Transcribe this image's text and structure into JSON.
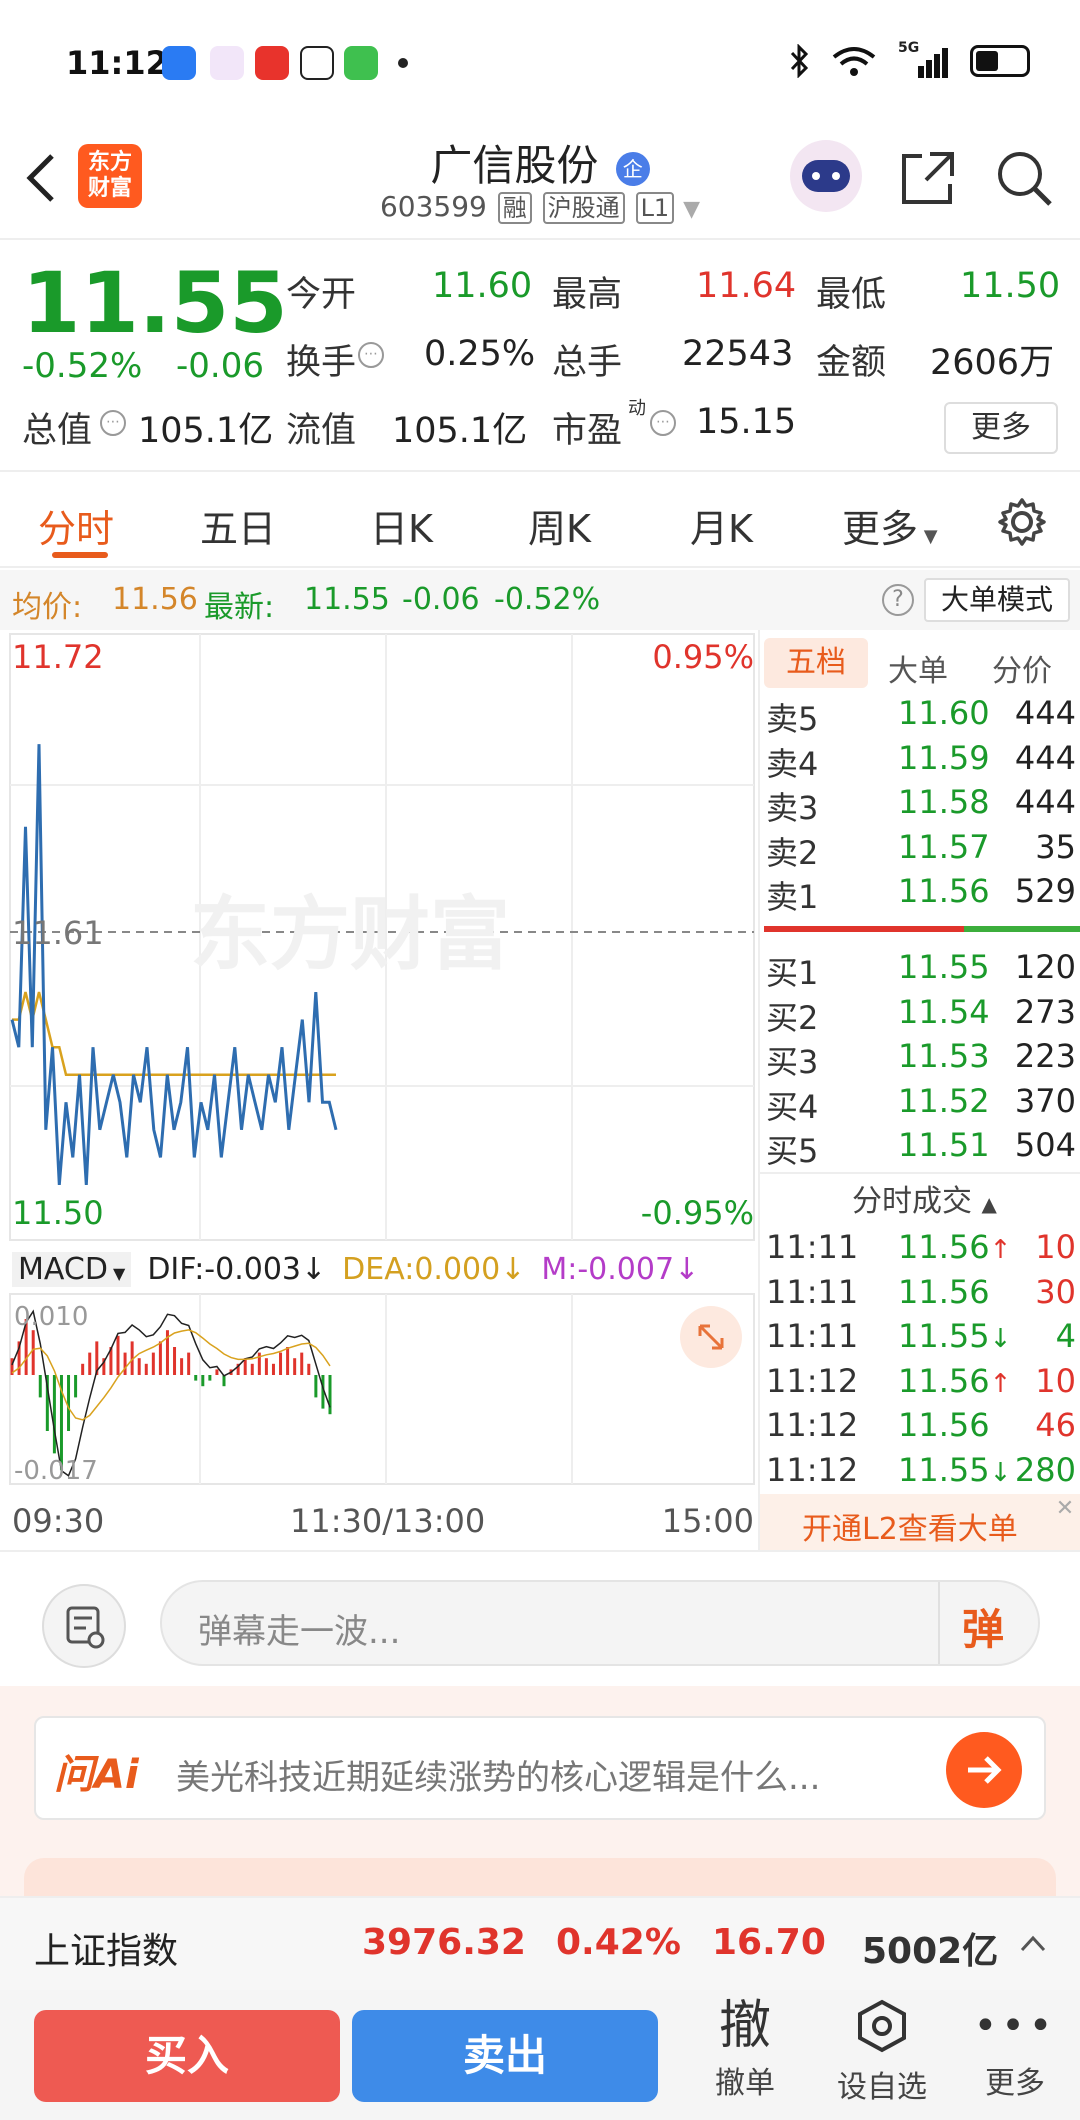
{
  "status_bar": {
    "time": "11:12",
    "network": "5G"
  },
  "header": {
    "title": "广信股份",
    "title_badge": "企",
    "app_logo_line1": "东方",
    "app_logo_line2": "财富",
    "code": "603599",
    "tags": [
      "融",
      "沪股通",
      "L1"
    ]
  },
  "quote": {
    "price": "11.55",
    "pct_change": "-0.52%",
    "abs_change": "-0.06",
    "fields": [
      {
        "label": "今开",
        "value": "11.60",
        "color": "green"
      },
      {
        "label": "最高",
        "value": "11.64",
        "color": "red"
      },
      {
        "label": "最低",
        "value": "11.50",
        "color": "green"
      },
      {
        "label": "换手",
        "value": "0.25%",
        "color": "black"
      },
      {
        "label": "总手",
        "value": "22543",
        "color": "black"
      },
      {
        "label": "金额",
        "value": "2606万",
        "color": "black"
      },
      {
        "label": "总值",
        "value": "105.1亿",
        "color": "black"
      },
      {
        "label": "流值",
        "value": "105.1亿",
        "color": "black"
      },
      {
        "label": "市盈",
        "value": "15.15",
        "color": "black"
      }
    ],
    "pe_superscript": "动",
    "more_label": "更多"
  },
  "tabs": [
    "分时",
    "五日",
    "日K",
    "周K",
    "月K",
    "更多"
  ],
  "info_line": {
    "avg_label": "均价:",
    "avg_value": "11.56",
    "latest_label": "最新:",
    "latest_value": "11.55",
    "latest_change": "-0.06",
    "latest_pct": "-0.52%",
    "big_order_mode": "大单模式"
  },
  "chart": {
    "y_top": "11.72",
    "y_mid": "11.61",
    "y_bottom": "11.50",
    "pct_top": "0.95%",
    "pct_bottom": "-0.95%",
    "watermark": "东方财富",
    "macd_label": "MACD",
    "dif": "DIF:-0.003",
    "dea": "DEA:0.000",
    "m": "M:-0.007",
    "macd_top": "0.010",
    "macd_bottom": "-0.017",
    "x_start": "09:30",
    "x_mid": "11:30/13:00",
    "x_end": "15:00"
  },
  "chart_data": {
    "type": "line",
    "series": [],
    "price_line": [
      11.58,
      11.57,
      11.65,
      11.57,
      11.68,
      11.54,
      11.57,
      11.52,
      11.55,
      11.53,
      11.56,
      11.52,
      11.57,
      11.54,
      11.55,
      11.56,
      11.55,
      11.53,
      11.56,
      11.55,
      11.57,
      11.54,
      11.53,
      11.56,
      11.54,
      11.55,
      11.57,
      11.53,
      11.55,
      11.54,
      11.56,
      11.53,
      11.55,
      11.57,
      11.54,
      11.56,
      11.55,
      11.54,
      11.56,
      11.55,
      11.57,
      11.54,
      11.56,
      11.58,
      11.55,
      11.59,
      11.55,
      11.55,
      11.54
    ],
    "avg_line": [
      11.58,
      11.58,
      11.59,
      11.58,
      11.59,
      11.58,
      11.57,
      11.57,
      11.56,
      11.56,
      11.56,
      11.56,
      11.56,
      11.56,
      11.56,
      11.56,
      11.56,
      11.56,
      11.56,
      11.56,
      11.56,
      11.56,
      11.56,
      11.56,
      11.56,
      11.56,
      11.56,
      11.56,
      11.56,
      11.56,
      11.56,
      11.56,
      11.56,
      11.56,
      11.56,
      11.56,
      11.56,
      11.56,
      11.56,
      11.56,
      11.56,
      11.56,
      11.56,
      11.56,
      11.56,
      11.56,
      11.56,
      11.56,
      11.56
    ],
    "macd_bars": [
      0.003,
      0.006,
      0.01,
      0.008,
      -0.004,
      -0.01,
      -0.014,
      -0.017,
      -0.01,
      -0.004,
      0.002,
      0.004,
      0.006,
      0.003,
      0.005,
      0.007,
      0.004,
      0.006,
      0.003,
      0.002,
      0.004,
      0.006,
      0.008,
      0.005,
      0.003,
      0.004,
      -0.001,
      -0.002,
      -0.001,
      0.001,
      -0.002,
      0.001,
      0.002,
      0.003,
      0.002,
      0.004,
      0.003,
      0.002,
      0.004,
      0.005,
      0.003,
      0.004,
      0.002,
      -0.004,
      -0.006,
      -0.007
    ],
    "ylim": [
      11.5,
      11.72
    ]
  },
  "orderbook": {
    "tabs": [
      "五档",
      "大单",
      "分价"
    ],
    "asks": [
      {
        "label": "卖5",
        "price": "11.60",
        "vol": "444"
      },
      {
        "label": "卖4",
        "price": "11.59",
        "vol": "444"
      },
      {
        "label": "卖3",
        "price": "11.58",
        "vol": "444"
      },
      {
        "label": "卖2",
        "price": "11.57",
        "vol": "35"
      },
      {
        "label": "卖1",
        "price": "11.56",
        "vol": "529"
      }
    ],
    "bids": [
      {
        "label": "买1",
        "price": "11.55",
        "vol": "120"
      },
      {
        "label": "买2",
        "price": "11.54",
        "vol": "273"
      },
      {
        "label": "买3",
        "price": "11.53",
        "vol": "223"
      },
      {
        "label": "买4",
        "price": "11.52",
        "vol": "370"
      },
      {
        "label": "买5",
        "price": "11.51",
        "vol": "504"
      }
    ],
    "trades_title": "分时成交",
    "trades": [
      {
        "time": "11:11",
        "price": "11.56",
        "dir": "up",
        "vol": "10",
        "vol_color": "red"
      },
      {
        "time": "11:11",
        "price": "11.56",
        "dir": "",
        "vol": "30",
        "vol_color": "red"
      },
      {
        "time": "11:11",
        "price": "11.55",
        "dir": "down",
        "vol": "4",
        "vol_color": "green"
      },
      {
        "time": "11:12",
        "price": "11.56",
        "dir": "up",
        "vol": "10",
        "vol_color": "red"
      },
      {
        "time": "11:12",
        "price": "11.56",
        "dir": "",
        "vol": "46",
        "vol_color": "red"
      },
      {
        "time": "11:12",
        "price": "11.55",
        "dir": "down",
        "vol": "280",
        "vol_color": "green"
      }
    ],
    "l2_banner": "开通L2查看大单"
  },
  "danmu": {
    "placeholder": "弹幕走一波...",
    "send_icon_label": "弹"
  },
  "ai_bar": {
    "logo": "问Ai",
    "question": "美光科技近期延续涨势的核心逻辑是什么..."
  },
  "index_bar": {
    "name": "上证指数",
    "value": "3976.32",
    "pct": "0.42%",
    "change": "16.70",
    "amount": "5002亿"
  },
  "actions": {
    "buy": "买入",
    "sell": "卖出",
    "cancel_glyph": "撤",
    "cancel": "撤单",
    "watchlist": "设自选",
    "more": "更多"
  }
}
